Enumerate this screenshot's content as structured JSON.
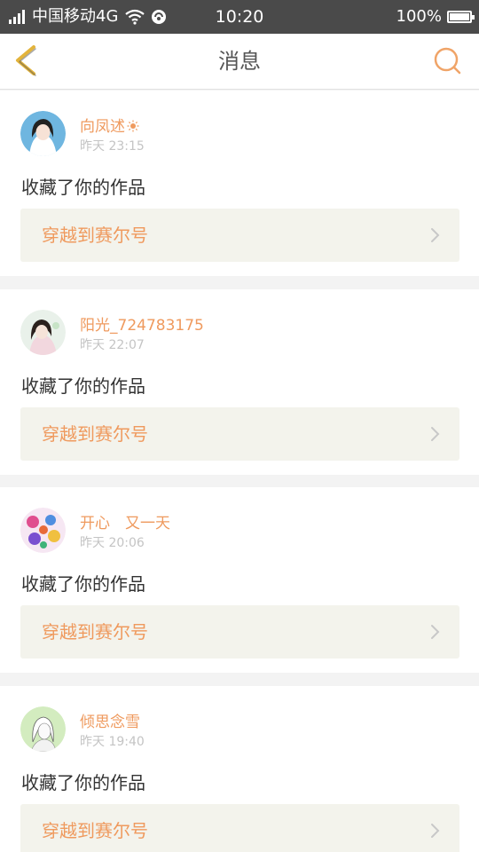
{
  "status_bar": {
    "carrier": "中国移动4G",
    "time": "10:20",
    "battery": "100%"
  },
  "nav": {
    "title": "消息",
    "icons": [
      "chevron-left-icon",
      "search-icon"
    ],
    "accent_color": "#e3b43c",
    "search_color": "#f0a468"
  },
  "messages": [
    {
      "username": "向凤述",
      "has_sun": true,
      "time": "昨天 23:15",
      "action": "收藏了你的作品",
      "work_title": "穿越到赛尔号"
    },
    {
      "username": "阳光_724783175",
      "has_sun": false,
      "time": "昨天 22:07",
      "action": "收藏了你的作品",
      "work_title": "穿越到赛尔号"
    },
    {
      "username": "开心　又一天",
      "has_sun": false,
      "time": "昨天 20:06",
      "action": "收藏了你的作品",
      "work_title": "穿越到赛尔号"
    },
    {
      "username": "倾思念雪",
      "has_sun": false,
      "time": "昨天 19:40",
      "action": "收藏了你的作品",
      "work_title": "穿越到赛尔号"
    }
  ],
  "colors": {
    "username": "#ef9a5e",
    "link_bg": "#f3f3ec",
    "status_bg": "#4a4a4a"
  }
}
